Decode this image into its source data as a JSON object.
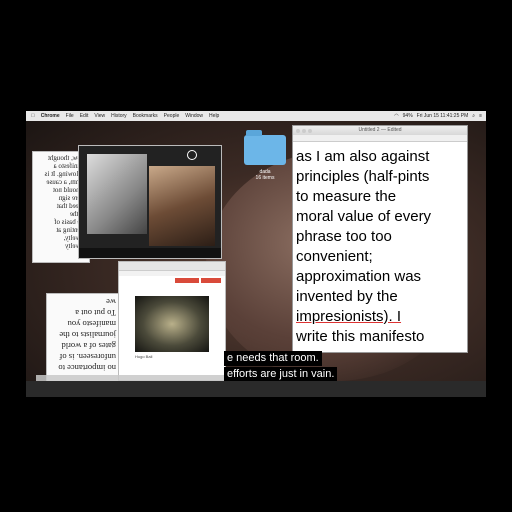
{
  "menubar": {
    "apple": "",
    "items": [
      "Chrome",
      "File",
      "Edit",
      "View",
      "History",
      "Bookmarks",
      "People",
      "Window",
      "Help"
    ],
    "clock": "Fri Jun 15  11:41:25 PM",
    "battery": "94%"
  },
  "folder_dada": {
    "name": "dada",
    "count": "16 items"
  },
  "textedit": {
    "title": "Untitled 2 — Edited",
    "lines": [
      "as I am also against",
      "principles (half-pints",
      "to measure the",
      "moral value of every",
      "phrase too too",
      "convenient;",
      "approximation was",
      "invented by the",
      "impresionists). I",
      "write this manifesto"
    ]
  },
  "subtitles": {
    "line1": "e needs that room.",
    "line2": "efforts are just in vain."
  },
  "left_windows": {
    "top_text": "wow, thought\nmanifesto a\nfollowing.  It is\n'hmm, a cause\nt should not\nmere sign\nl need that\nof the\nthe basis of\nmenting at\nnovelty,\nnovelty",
    "bottom_text": "no importance to\nunforeseen. is of\ngates of a world\njournalists to the\nmanifesto you\nTo put out a\nwe",
    "bottom_highlight": "no importance to"
  },
  "photo_caption": "Hugo Ball"
}
